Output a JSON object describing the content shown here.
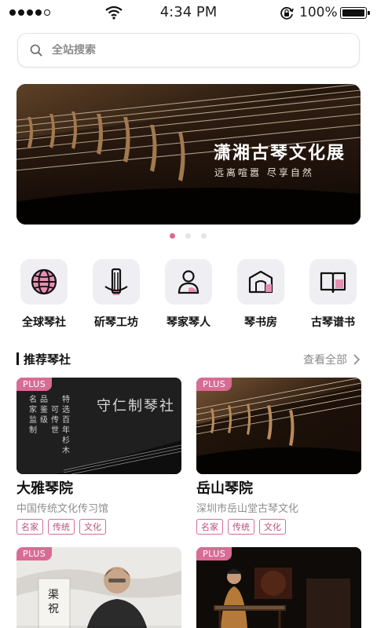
{
  "status": {
    "time": "4:34 PM",
    "battery": "100%"
  },
  "search": {
    "placeholder": "全站搜索"
  },
  "banner": {
    "title": "潇湘古琴文化展",
    "subtitle": "远离喧嚣  尽享自然",
    "page_count": 3,
    "active_page": 1
  },
  "categories": [
    {
      "label": "全球琴社",
      "icon": "globe-icon"
    },
    {
      "label": "斫琴工坊",
      "icon": "guqin-workshop-icon"
    },
    {
      "label": "琴家琴人",
      "icon": "person-icon"
    },
    {
      "label": "琴书房",
      "icon": "house-icon"
    },
    {
      "label": "古琴谱书",
      "icon": "book-icon"
    }
  ],
  "section": {
    "title": "推荐琴社",
    "view_all": "查看全部"
  },
  "cards": [
    {
      "badge": "PLUS",
      "name": "大雅琴院",
      "desc": "中国传统文化传习馆",
      "tags": [
        "名家",
        "传统",
        "文化"
      ],
      "image_text": {
        "brand": "守仁制琴社",
        "col1": "名家监制",
        "col2": "品鉴级",
        "col3": "可传世",
        "col4": "特选百年杉木"
      }
    },
    {
      "badge": "PLUS",
      "name": "岳山琴院",
      "desc": "深圳市岳山堂古琴文化",
      "tags": [
        "名家",
        "传统",
        "文化"
      ]
    },
    {
      "badge": "PLUS",
      "image_text": {
        "scroll": "渠祝"
      }
    },
    {
      "badge": "PLUS"
    }
  ],
  "colors": {
    "accent": "#d96a94",
    "tile_bg": "#efeff3"
  }
}
